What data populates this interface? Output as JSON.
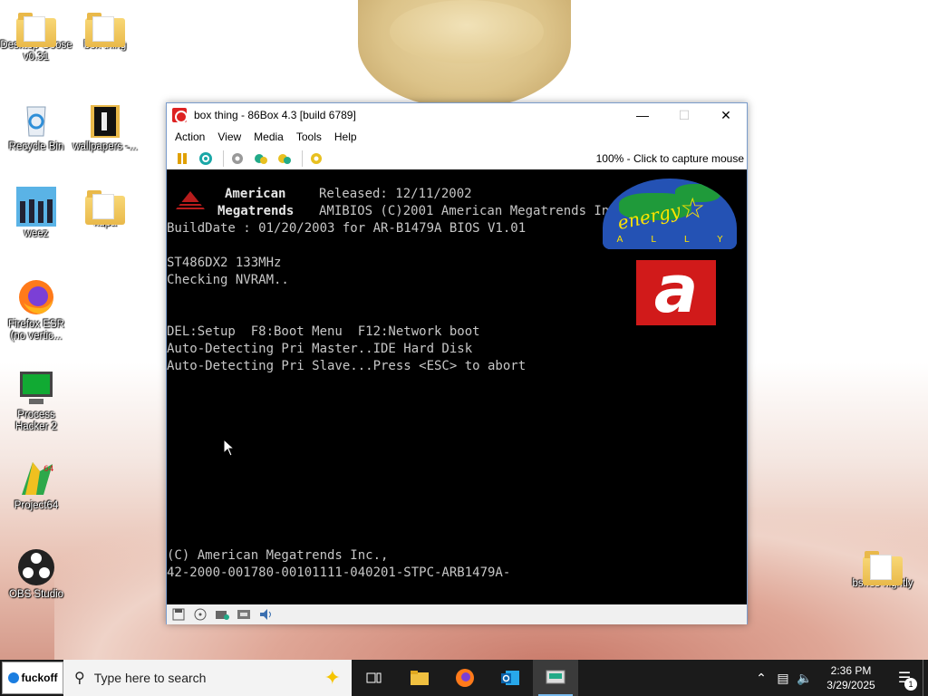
{
  "desktop": {
    "icons": [
      {
        "label": "Desktop Goose v0.31",
        "icon": "folder-icon"
      },
      {
        "label": "box thing",
        "icon": "folder-icon"
      },
      {
        "label": "Recycle Bin",
        "icon": "recycle-bin-icon"
      },
      {
        "label": "wallpapers -...",
        "icon": "folder-icon"
      },
      {
        "label": "weez",
        "icon": "image-file-icon"
      },
      {
        "label": "kupa",
        "icon": "folder-icon"
      },
      {
        "label": "Firefox ESR (no vertic...",
        "icon": "firefox-icon"
      },
      {
        "label": "Process Hacker 2",
        "icon": "process-hacker-icon"
      },
      {
        "label": "Project64",
        "icon": "project64-icon"
      },
      {
        "label": "OBS Studio",
        "icon": "obs-icon"
      },
      {
        "label": "bsnes nightly",
        "icon": "folder-icon"
      }
    ]
  },
  "window": {
    "title": "box thing - 86Box 4.3 [build 6789]",
    "menu": [
      "Action",
      "View",
      "Media",
      "Tools",
      "Help"
    ],
    "capture_text": "100% - Click to capture mouse"
  },
  "bios": {
    "logo_line1": "American",
    "logo_line2": "Megatrends",
    "released": "Released: 12/11/2002",
    "copyright_header": "AMIBIOS (C)2001 American Megatrends Inc",
    "build_date": "BuildDate : 01/20/2003 for AR-B1479A BIOS V1.01",
    "cpu": "ST486DX2 133MHz",
    "nvram": "Checking NVRAM..",
    "keys": "DEL:Setup  F8:Boot Menu  F12:Network boot",
    "pri_master": "Auto-Detecting Pri Master..IDE Hard Disk",
    "pri_slave": "Auto-Detecting Pri Slave...Press <ESC> to abort",
    "footer1": "(C) American Megatrends Inc.,",
    "footer2": "42-2000-001780-00101111-040201-STPC-ARB1479A-",
    "energy_word": "energy",
    "energy_ally": [
      "A",
      "L",
      "L",
      "Y"
    ],
    "a_logo": "a"
  },
  "taskbar": {
    "start_label": "fuckoff",
    "search_placeholder": "Type here to search",
    "time": "2:36 PM",
    "date": "3/29/2025",
    "notification_count": "1"
  },
  "colors": {
    "taskbar_bg": "#1b1b1b",
    "screen_bg": "#000000",
    "bios_text": "#c7c7c7"
  }
}
